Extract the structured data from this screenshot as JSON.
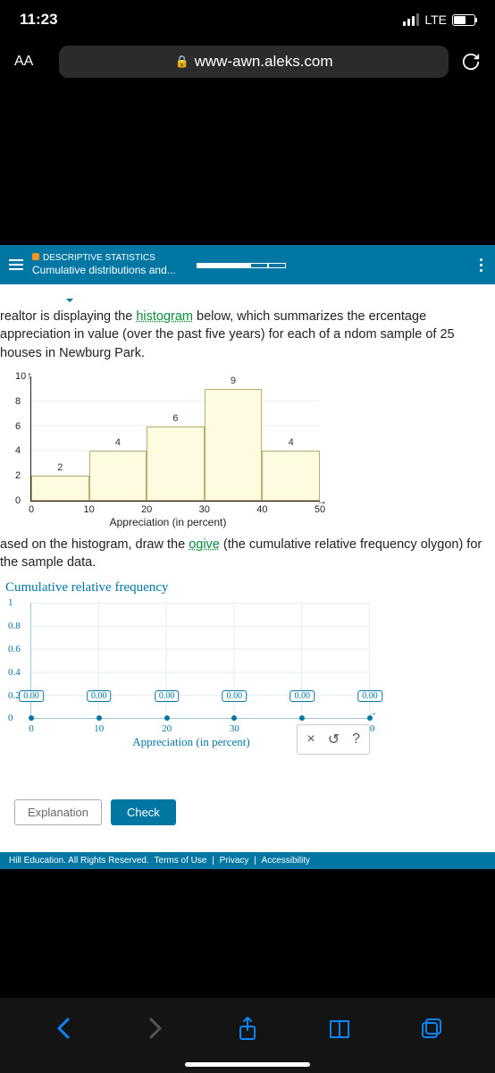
{
  "status": {
    "time": "11:23",
    "carrier": "LTE"
  },
  "browser": {
    "aa": "AA",
    "url": "www-awn.aleks.com"
  },
  "aleks": {
    "category": "DESCRIPTIVE STATISTICS",
    "topic": "Cumulative distributions and...",
    "dropdown_blank": ""
  },
  "text": {
    "p1a": "realtor is displaying the ",
    "p1_link": "histogram",
    "p1b": " below, which summarizes the ercentage appreciation in value (over the past five years) for each of a ndom sample of ",
    "p1_n": "25",
    "p1c": " houses in Newburg Park.",
    "p2a": "ased on the histogram, draw the ",
    "p2_link": "ogive",
    "p2b": " (the cumulative relative frequency olygon) for the sample data."
  },
  "chart_data": [
    {
      "type": "bar",
      "title": "",
      "categories": [
        "0-10",
        "10-20",
        "20-30",
        "30-40",
        "40-50"
      ],
      "values": [
        2,
        4,
        6,
        9,
        4
      ],
      "xlabel": "Appreciation (in percent)",
      "ylabel": "",
      "y_ticks": [
        0,
        2,
        4,
        6,
        8,
        10
      ],
      "x_ticks": [
        0,
        10,
        20,
        30,
        40,
        50
      ],
      "ylim": [
        0,
        10
      ]
    },
    {
      "type": "line",
      "title": "Cumulative relative frequency",
      "x": [
        0,
        10,
        20,
        30,
        40,
        50
      ],
      "values": [
        0.0,
        0.0,
        0.0,
        0.0,
        0.0,
        0.0
      ],
      "editable": true,
      "xlabel": "Appreciation (in percent)",
      "y_ticks": [
        0,
        0.2,
        0.4,
        0.6,
        0.8,
        1
      ],
      "x_ticks": [
        0,
        10,
        20,
        30,
        40,
        50
      ],
      "ylim": [
        0,
        1
      ]
    }
  ],
  "ogive_title": "Cumulative relative frequency",
  "ogive_xlabel": "Appreciation (in percent)",
  "hist_xlabel": "Appreciation (in percent)",
  "hist": {
    "y": [
      "10",
      "8",
      "6",
      "4",
      "2",
      "0"
    ],
    "x": [
      "0",
      "10",
      "20",
      "30",
      "40",
      "50"
    ],
    "bars": [
      "2",
      "4",
      "6",
      "9",
      "4"
    ]
  },
  "ogive": {
    "y": [
      "1",
      "0.8",
      "0.6",
      "0.4",
      "0.2",
      "0"
    ],
    "x": [
      "0",
      "10",
      "20",
      "30",
      "40",
      "50"
    ],
    "pts": [
      "0.00",
      "0.00",
      "0.00",
      "0.00",
      "0.00",
      "0.00"
    ]
  },
  "tools": {
    "close": "×",
    "undo": "↺",
    "help": "?"
  },
  "buttons": {
    "explanation": "Explanation",
    "check": "Check"
  },
  "footer": {
    "copyright": "Hill Education. All Rights Reserved.",
    "terms": "Terms of Use",
    "privacy": "Privacy",
    "accessibility": "Accessibility"
  }
}
